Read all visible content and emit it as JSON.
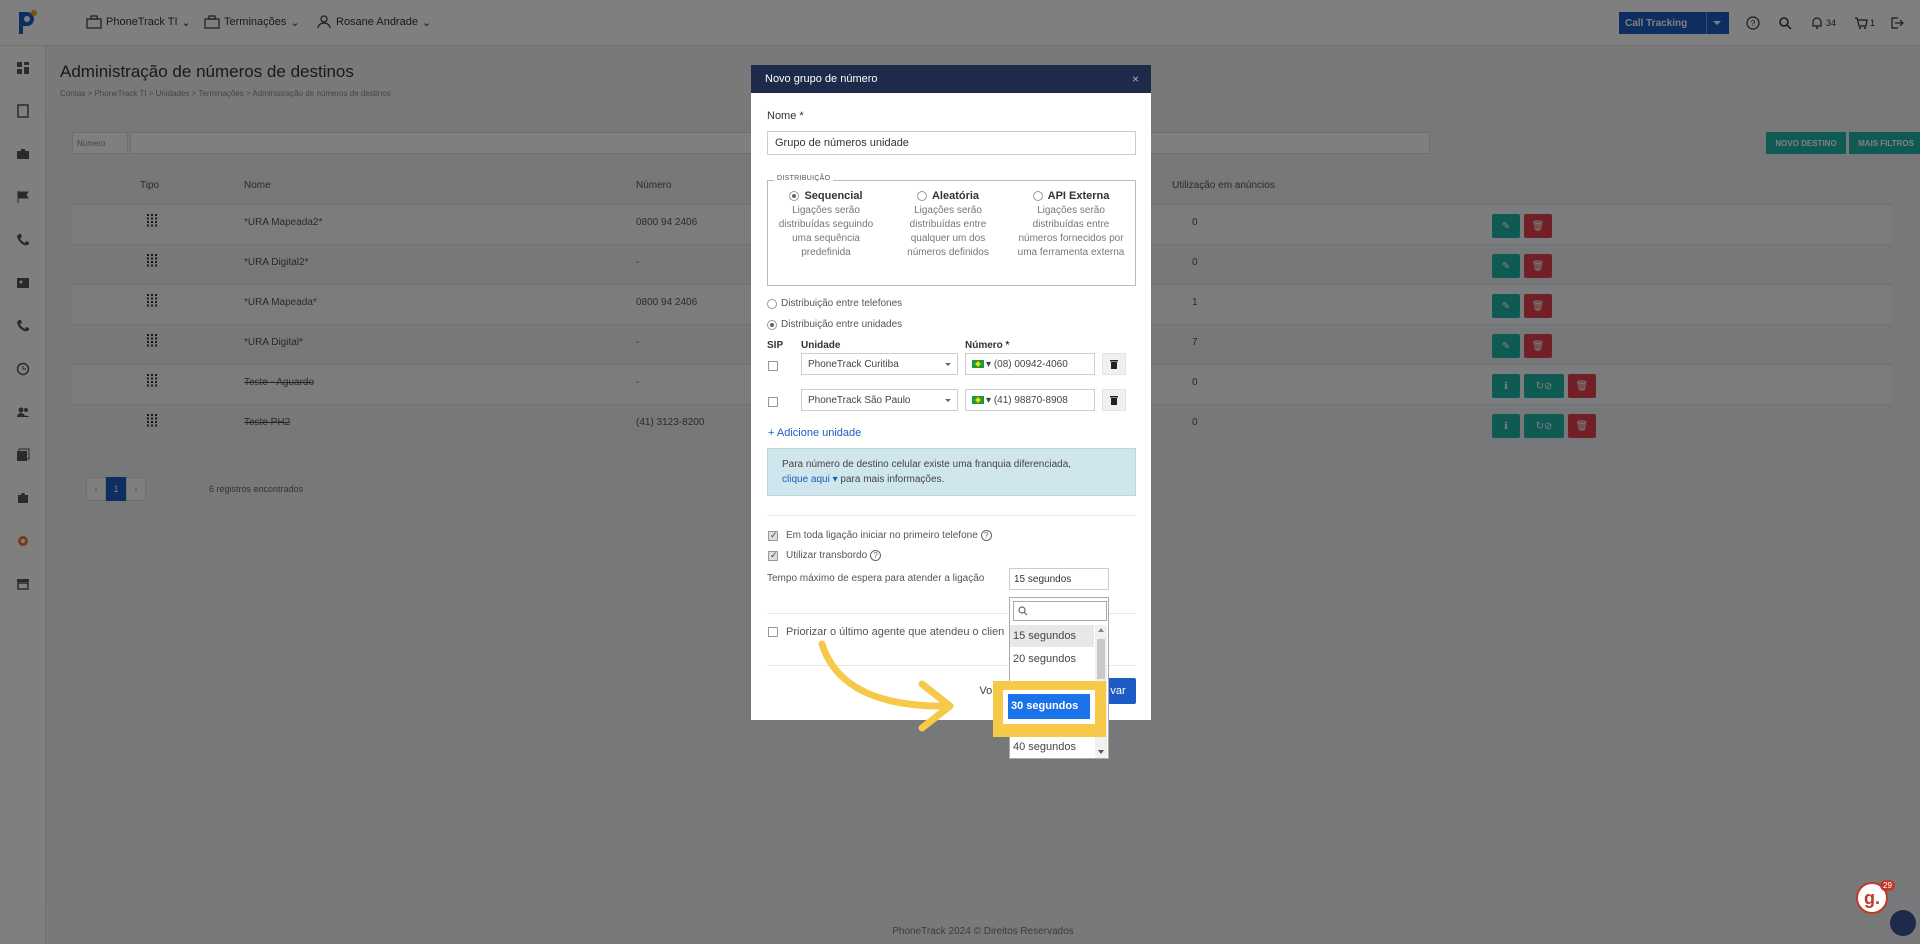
{
  "topbar": {
    "nav": [
      {
        "label": "PhoneTrack TI",
        "icon": "briefcase-icon"
      },
      {
        "label": "Terminações",
        "icon": "briefcase-icon"
      },
      {
        "label": "Rosane Andrade",
        "icon": "user-icon"
      }
    ],
    "product_button": "Call Tracking",
    "notifications_count": "34",
    "cart_count": "1"
  },
  "page": {
    "title": "Administração de números de destinos",
    "breadcrumb": "Contas  >  PhoneTrack TI  >  Unidades  >  Terminações  >  Administração de números de destinos"
  },
  "filters": {
    "field_select": "Número",
    "new_button": "NOVO DESTINO",
    "more_button": "MAIS FILTROS"
  },
  "table": {
    "headers": {
      "tipo": "Tipo",
      "nome": "Nome",
      "numero": "Número",
      "uso": "Utilização em anúncios"
    },
    "rows": [
      {
        "nome": "*URA Mapeada2*",
        "numero": "0800 94 2406",
        "uso": "0",
        "strike": false
      },
      {
        "nome": "*URA Digital2*",
        "numero": "-",
        "uso": "0",
        "strike": false
      },
      {
        "nome": "*URA Mapeada*",
        "numero": "0800 94 2406",
        "uso": "1",
        "strike": false
      },
      {
        "nome": "*URA Digital*",
        "numero": "-",
        "uso": "7",
        "strike": false
      },
      {
        "nome": "Teste - Aguardo",
        "numero": "-",
        "uso": "0",
        "strike": true
      },
      {
        "nome": "Teste PH2",
        "numero": "(41) 3123-8200",
        "uso": "0",
        "strike": true
      }
    ]
  },
  "pagination": {
    "prev": "‹",
    "current": "1",
    "next": "›",
    "summary": "6 registros encontrados"
  },
  "footer": "PhoneTrack 2024 © Direitos Reservados",
  "modal": {
    "title": "Novo grupo de número",
    "close": "×",
    "name_label": "Nome *",
    "name_value": "Grupo de números unidade",
    "distribution_legend": "DISTRIBUIÇÃO",
    "distribution_options": [
      {
        "title": "Sequencial",
        "desc": "Ligações serão distribuídas seguindo uma sequência predefinida",
        "selected": true
      },
      {
        "title": "Aleatória",
        "desc": "Ligações serão distribuídas entre qualquer um dos números definidos",
        "selected": false
      },
      {
        "title": "API Externa",
        "desc": "Ligações serão distribuídas entre números fornecidos por uma ferramenta externa",
        "selected": false
      }
    ],
    "dist_phones": "Distribuição entre telefones",
    "dist_units": "Distribuição entre unidades",
    "col_sip": "SIP",
    "col_unidade": "Unidade",
    "col_numero": "Número *",
    "units": [
      {
        "unidade": "PhoneTrack Curitiba",
        "numero": "(08) 00942-4060"
      },
      {
        "unidade": "PhoneTrack São Paulo",
        "numero": "(41) 98870-8908"
      }
    ],
    "add_unit": "+ Adicione unidade",
    "info_text": "Para número de destino celular existe uma franquia diferenciada,",
    "info_link": "clique aqui",
    "info_text2": "para mais informações.",
    "check_first_phone": "Em toda ligação iniciar no primeiro telefone",
    "check_overflow": "Utilizar transbordo",
    "max_wait_label": "Tempo máximo de espera para atender a ligação",
    "max_wait_value": "15 segundos",
    "check_priority": "Priorizar o último agente que atendeu o clien",
    "back_button": "Vol",
    "save_button": "var"
  },
  "dropdown": {
    "options": [
      "15 segundos",
      "20 segundos",
      "30 segundos",
      "40 segundos"
    ],
    "highlighted": "30 segundos"
  },
  "widget": {
    "badge_letter": "g.",
    "badge_count": "29"
  },
  "colors": {
    "brand_blue": "#1d5cc4",
    "teal": "#1fb6a8",
    "red": "#e5404f",
    "navy": "#1e2a4a",
    "highlight_yellow": "#f7c948"
  }
}
